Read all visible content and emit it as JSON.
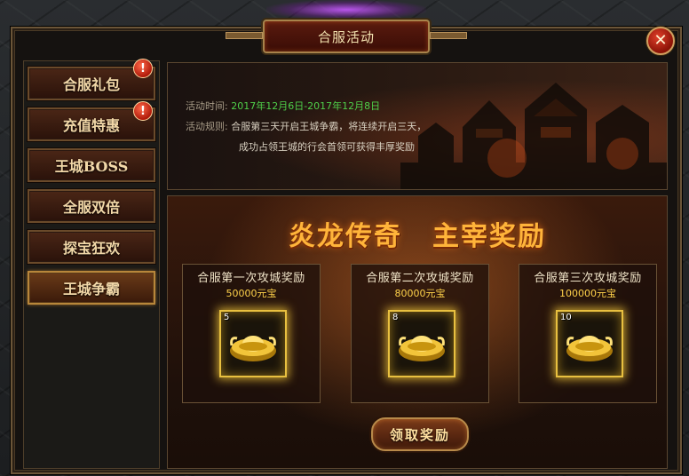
{
  "window": {
    "title": "合服活动",
    "close_label": "✕"
  },
  "sidebar": {
    "items": [
      {
        "label": "合服礼包",
        "badge": "!",
        "active": false
      },
      {
        "label": "充值特惠",
        "badge": "!",
        "active": false
      },
      {
        "label": "王城BOSS",
        "badge": "",
        "active": false
      },
      {
        "label": "全服双倍",
        "badge": "",
        "active": false
      },
      {
        "label": "探宝狂欢",
        "badge": "",
        "active": false
      },
      {
        "label": "王城争霸",
        "badge": "",
        "active": true
      }
    ]
  },
  "info": {
    "time_label": "活动时间:",
    "time_value": "2017年12月6日-2017年12月8日",
    "rule_label": "活动规则:",
    "rule_line1": "合服第三天开启王城争霸，将连续开启三天，",
    "rule_line2": "成功占领王城的行会首领可获得丰厚奖励"
  },
  "rewards": {
    "title_part1": "炎龙传奇",
    "title_part2": "主宰奖励",
    "cards": [
      {
        "title": "合服第一次攻城奖励",
        "amount": "50000元宝",
        "item_count": "5",
        "item_icon": "gold-ingot-icon"
      },
      {
        "title": "合服第二次攻城奖励",
        "amount": "80000元宝",
        "item_count": "8",
        "item_icon": "gold-ingot-icon"
      },
      {
        "title": "合服第三次攻城奖励",
        "amount": "100000元宝",
        "item_count": "10",
        "item_icon": "gold-ingot-icon"
      }
    ],
    "claim_label": "领取奖励"
  },
  "colors": {
    "accent_gold": "#ffb43a",
    "date_green": "#4fd04a",
    "amount_yellow": "#ffd24a"
  }
}
